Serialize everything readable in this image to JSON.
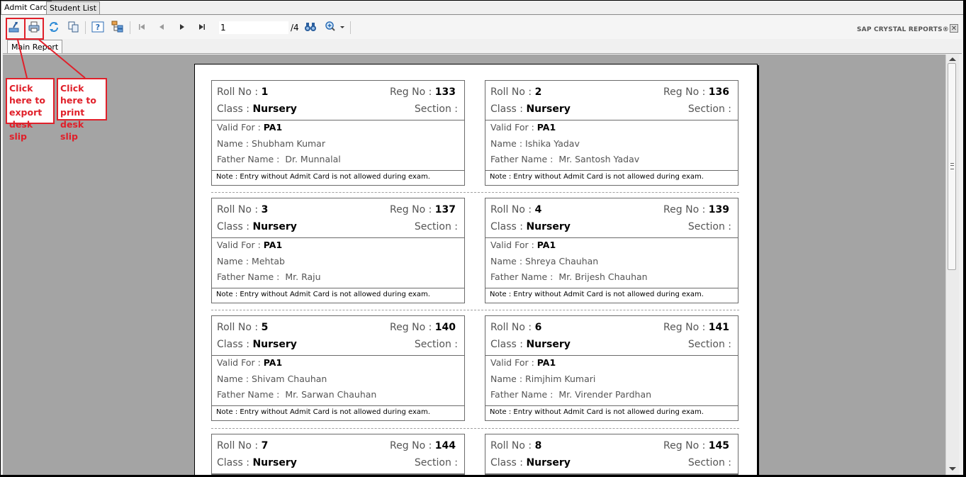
{
  "tabs": [
    "Admit Card",
    "Student List"
  ],
  "toolbar": {
    "current_page": "1",
    "page_total": "/4",
    "brand": "SAP CRYSTAL REPORTS®"
  },
  "report_tab": "Main Report",
  "annotations": {
    "export": "Click here to export desk slip",
    "print": "Click here to print desk slip"
  },
  "labels": {
    "roll": "Roll No :",
    "reg": "Reg No :",
    "class": "Class :",
    "section": "Section :",
    "valid": "Valid For :",
    "name": "Name :",
    "father": "Father Name :",
    "note": "Note : Entry without Admit Card is not allowed during exam."
  },
  "cards": [
    {
      "roll": "1",
      "reg": "133",
      "class": "Nursery",
      "valid": "PA1",
      "name": "Shubham Kumar",
      "father": "Dr. Munnalal"
    },
    {
      "roll": "2",
      "reg": "136",
      "class": "Nursery",
      "valid": "PA1",
      "name": "Ishika Yadav",
      "father": "Mr. Santosh Yadav"
    },
    {
      "roll": "3",
      "reg": "137",
      "class": "Nursery",
      "valid": "PA1",
      "name": "Mehtab",
      "father": "Mr. Raju"
    },
    {
      "roll": "4",
      "reg": "139",
      "class": "Nursery",
      "valid": "PA1",
      "name": "Shreya Chauhan",
      "father": "Mr. Brijesh Chauhan"
    },
    {
      "roll": "5",
      "reg": "140",
      "class": "Nursery",
      "valid": "PA1",
      "name": "Shivam Chauhan",
      "father": "Mr. Sarwan Chauhan"
    },
    {
      "roll": "6",
      "reg": "141",
      "class": "Nursery",
      "valid": "PA1",
      "name": "Rimjhim Kumari",
      "father": "Mr. Virender Pardhan"
    },
    {
      "roll": "7",
      "reg": "144",
      "class": "Nursery"
    },
    {
      "roll": "8",
      "reg": "145",
      "class": "Nursery"
    }
  ]
}
